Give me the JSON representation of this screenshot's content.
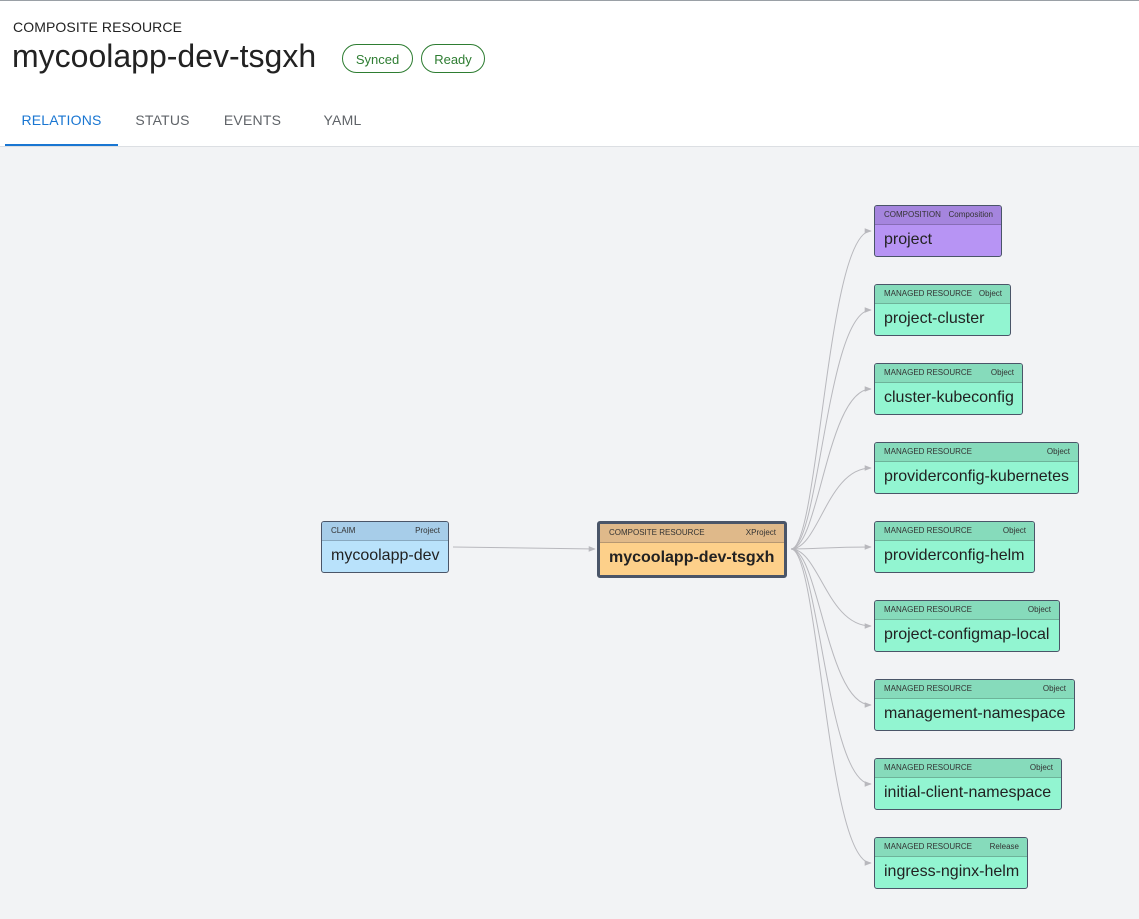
{
  "header": {
    "kind_label": "COMPOSITE RESOURCE",
    "title": "mycoolapp-dev-tsgxh",
    "badges": [
      "Synced",
      "Ready"
    ]
  },
  "tabs": [
    {
      "label": "RELATIONS",
      "active": true
    },
    {
      "label": "STATUS",
      "active": false
    },
    {
      "label": "EVENTS",
      "active": false
    },
    {
      "label": "YAML",
      "active": false
    }
  ],
  "graph": {
    "claim": {
      "type": "CLAIM",
      "kind": "Project",
      "name": "mycoolapp-dev"
    },
    "composite": {
      "type": "COMPOSITE RESOURCE",
      "kind": "XProject",
      "name": "mycoolapp-dev-tsgxh"
    },
    "children": [
      {
        "type": "COMPOSITION",
        "kind": "Composition",
        "name": "project"
      },
      {
        "type": "MANAGED RESOURCE",
        "kind": "Object",
        "name": "project-cluster"
      },
      {
        "type": "MANAGED RESOURCE",
        "kind": "Object",
        "name": "cluster-kubeconfig"
      },
      {
        "type": "MANAGED RESOURCE",
        "kind": "Object",
        "name": "providerconfig-kubernetes"
      },
      {
        "type": "MANAGED RESOURCE",
        "kind": "Object",
        "name": "providerconfig-helm"
      },
      {
        "type": "MANAGED RESOURCE",
        "kind": "Object",
        "name": "project-configmap-local"
      },
      {
        "type": "MANAGED RESOURCE",
        "kind": "Object",
        "name": "management-namespace"
      },
      {
        "type": "MANAGED RESOURCE",
        "kind": "Object",
        "name": "initial-client-namespace"
      },
      {
        "type": "MANAGED RESOURCE",
        "kind": "Release",
        "name": "ingress-nginx-helm"
      }
    ]
  },
  "colors": {
    "accent": "#1976d2",
    "badge": "#2e7d32",
    "claim": "#b9e2fb",
    "composite": "#fdd08a",
    "composition": "#b794f4",
    "managed": "#92f5d1",
    "edge": "#b8b8bd"
  }
}
